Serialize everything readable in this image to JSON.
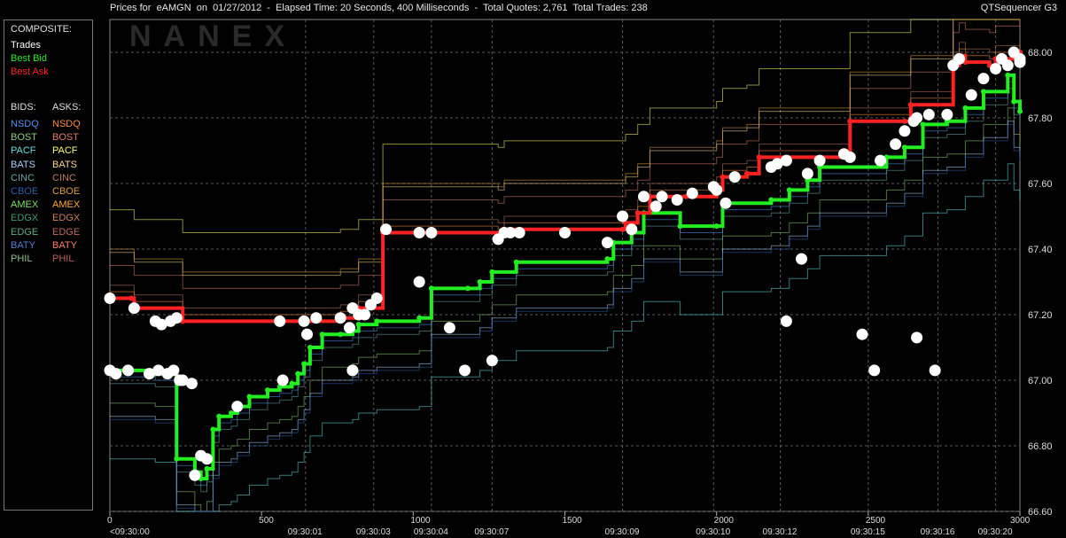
{
  "header": {
    "title": "Prices for  eAMGN  on  01/27/2012  -  Elapsed Time: 20 Seconds, 400 Milliseconds  -  Total Quotes: 2,761  Total Trades: 238",
    "app_name": "QTSequencer G3"
  },
  "watermark": "NANEX",
  "legend": {
    "composite_heading": "COMPOSITE:",
    "composite": [
      {
        "label": "Trades",
        "color": "#ffffff"
      },
      {
        "label": "Best Bid",
        "color": "#22ee22"
      },
      {
        "label": "Best Ask",
        "color": "#ff2222"
      }
    ],
    "bids_heading": "BIDS:",
    "asks_heading": "ASKS:",
    "bids": [
      {
        "label": "NSDQ",
        "color": "#4f8ff0"
      },
      {
        "label": "BOST",
        "color": "#8ed07a"
      },
      {
        "label": "PACF",
        "color": "#5fe0e0"
      },
      {
        "label": "BATS",
        "color": "#a8d0ff"
      },
      {
        "label": "CINC",
        "color": "#6aa7a7"
      },
      {
        "label": "CBOE",
        "color": "#2f5fb0"
      },
      {
        "label": "AMEX",
        "color": "#7be06a"
      },
      {
        "label": "EDGX",
        "color": "#3f9f6a"
      },
      {
        "label": "EDGE",
        "color": "#5fb080"
      },
      {
        "label": "BATY",
        "color": "#5a7fd0"
      },
      {
        "label": "PHIL",
        "color": "#8fbf8f"
      }
    ],
    "asks": [
      {
        "label": "NSDQ",
        "color": "#ff8c3a"
      },
      {
        "label": "BOST",
        "color": "#e07a6a"
      },
      {
        "label": "PACF",
        "color": "#ffff66"
      },
      {
        "label": "BATS",
        "color": "#ffd890"
      },
      {
        "label": "CINC",
        "color": "#c07a60"
      },
      {
        "label": "CBOE",
        "color": "#e0a040"
      },
      {
        "label": "AMEX",
        "color": "#ffaa22"
      },
      {
        "label": "EDGX",
        "color": "#d08060"
      },
      {
        "label": "EDGE",
        "color": "#c06a5a"
      },
      {
        "label": "BATY",
        "color": "#ff7a6a"
      },
      {
        "label": "PHIL",
        "color": "#c06060"
      }
    ]
  },
  "chart_data": {
    "type": "line",
    "xlim": [
      0,
      3000
    ],
    "ylim": [
      66.6,
      68.1
    ],
    "x_ticks": [
      0,
      500,
      1000,
      1500,
      2000,
      2500,
      3000
    ],
    "y_ticks": [
      "66.60",
      "66.80",
      "67.00",
      "67.20",
      "67.40",
      "67.60",
      "67.80",
      "68.00"
    ],
    "time_labels": [
      {
        "x": 0,
        "label": "<09:30:00"
      },
      {
        "x": 645,
        "label": "09:30:01"
      },
      {
        "x": 870,
        "label": "09:30:03"
      },
      {
        "x": 1060,
        "label": "09:30:04"
      },
      {
        "x": 1260,
        "label": "09:30:07"
      },
      {
        "x": 1690,
        "label": "09:30:09"
      },
      {
        "x": 1990,
        "label": "09:30:10"
      },
      {
        "x": 2210,
        "label": "09:30:12"
      },
      {
        "x": 2500,
        "label": "09:30:15"
      },
      {
        "x": 2730,
        "label": "09:30:16"
      },
      {
        "x": 2920,
        "label": "09:30:20"
      }
    ],
    "series": [
      {
        "name": "Best Bid",
        "color": "#22ee22",
        "points": [
          [
            0,
            67.03
          ],
          [
            150,
            67.02
          ],
          [
            200,
            67.02
          ],
          [
            220,
            66.76
          ],
          [
            280,
            66.72
          ],
          [
            300,
            66.7
          ],
          [
            320,
            66.73
          ],
          [
            340,
            66.85
          ],
          [
            360,
            66.89
          ],
          [
            400,
            66.9
          ],
          [
            420,
            66.92
          ],
          [
            460,
            66.95
          ],
          [
            520,
            66.97
          ],
          [
            560,
            66.98
          ],
          [
            600,
            66.99
          ],
          [
            620,
            67.02
          ],
          [
            640,
            67.05
          ],
          [
            660,
            67.1
          ],
          [
            700,
            67.14
          ],
          [
            760,
            67.14
          ],
          [
            800,
            67.15
          ],
          [
            820,
            67.17
          ],
          [
            880,
            67.18
          ],
          [
            1020,
            67.19
          ],
          [
            1060,
            67.28
          ],
          [
            1180,
            67.28
          ],
          [
            1220,
            67.3
          ],
          [
            1260,
            67.33
          ],
          [
            1340,
            67.36
          ],
          [
            1640,
            67.37
          ],
          [
            1660,
            67.42
          ],
          [
            1720,
            67.45
          ],
          [
            1760,
            67.51
          ],
          [
            1880,
            67.47
          ],
          [
            2000,
            67.47
          ],
          [
            2020,
            67.54
          ],
          [
            2180,
            67.55
          ],
          [
            2240,
            67.58
          ],
          [
            2300,
            67.61
          ],
          [
            2340,
            67.65
          ],
          [
            2560,
            67.68
          ],
          [
            2620,
            67.71
          ],
          [
            2680,
            67.78
          ],
          [
            2760,
            67.79
          ],
          [
            2820,
            67.83
          ],
          [
            2880,
            67.88
          ],
          [
            2960,
            67.93
          ],
          [
            2980,
            67.85
          ],
          [
            3000,
            67.82
          ]
        ]
      },
      {
        "name": "Best Ask",
        "color": "#ff2222",
        "points": [
          [
            0,
            67.25
          ],
          [
            70,
            67.25
          ],
          [
            80,
            67.22
          ],
          [
            240,
            67.18
          ],
          [
            560,
            67.18
          ],
          [
            760,
            67.19
          ],
          [
            820,
            67.22
          ],
          [
            900,
            67.45
          ],
          [
            1020,
            67.45
          ],
          [
            1280,
            67.44
          ],
          [
            1300,
            67.46
          ],
          [
            1690,
            67.46
          ],
          [
            1700,
            67.48
          ],
          [
            1740,
            67.51
          ],
          [
            1780,
            67.56
          ],
          [
            1900,
            67.56
          ],
          [
            2000,
            67.58
          ],
          [
            2020,
            67.62
          ],
          [
            2100,
            67.63
          ],
          [
            2140,
            67.68
          ],
          [
            2420,
            67.68
          ],
          [
            2440,
            67.79
          ],
          [
            2620,
            67.79
          ],
          [
            2640,
            67.84
          ],
          [
            2780,
            67.96
          ],
          [
            2800,
            67.99
          ],
          [
            2820,
            67.97
          ],
          [
            2900,
            67.96
          ],
          [
            2920,
            67.98
          ],
          [
            3000,
            68.0
          ]
        ]
      }
    ],
    "trades": [
      [
        0,
        67.25
      ],
      [
        0,
        67.03
      ],
      [
        20,
        67.02
      ],
      [
        60,
        67.03
      ],
      [
        80,
        67.22
      ],
      [
        130,
        67.02
      ],
      [
        150,
        67.18
      ],
      [
        160,
        67.03
      ],
      [
        170,
        67.17
      ],
      [
        190,
        67.02
      ],
      [
        200,
        67.18
      ],
      [
        210,
        67.03
      ],
      [
        220,
        67.19
      ],
      [
        230,
        67.0
      ],
      [
        240,
        67.0
      ],
      [
        270,
        66.99
      ],
      [
        280,
        66.71
      ],
      [
        300,
        66.77
      ],
      [
        320,
        66.76
      ],
      [
        420,
        66.92
      ],
      [
        560,
        67.18
      ],
      [
        570,
        67.0
      ],
      [
        640,
        67.18
      ],
      [
        650,
        67.14
      ],
      [
        680,
        67.19
      ],
      [
        760,
        67.19
      ],
      [
        790,
        67.16
      ],
      [
        800,
        67.03
      ],
      [
        800,
        67.22
      ],
      [
        820,
        67.2
      ],
      [
        840,
        67.2
      ],
      [
        860,
        67.23
      ],
      [
        880,
        67.25
      ],
      [
        910,
        67.46
      ],
      [
        1020,
        67.45
      ],
      [
        1020,
        67.3
      ],
      [
        1060,
        67.45
      ],
      [
        1120,
        67.16
      ],
      [
        1170,
        67.03
      ],
      [
        1260,
        67.06
      ],
      [
        1280,
        67.43
      ],
      [
        1300,
        67.45
      ],
      [
        1320,
        67.45
      ],
      [
        1350,
        67.45
      ],
      [
        1500,
        67.45
      ],
      [
        1640,
        67.42
      ],
      [
        1690,
        67.5
      ],
      [
        1720,
        67.46
      ],
      [
        1760,
        67.56
      ],
      [
        1800,
        67.53
      ],
      [
        1820,
        67.56
      ],
      [
        1870,
        67.55
      ],
      [
        1920,
        67.57
      ],
      [
        1990,
        67.59
      ],
      [
        2000,
        67.58
      ],
      [
        2030,
        67.54
      ],
      [
        2060,
        67.62
      ],
      [
        2180,
        67.65
      ],
      [
        2200,
        67.66
      ],
      [
        2230,
        67.67
      ],
      [
        2280,
        67.37
      ],
      [
        2230,
        67.18
      ],
      [
        2300,
        67.63
      ],
      [
        2340,
        67.67
      ],
      [
        2420,
        67.69
      ],
      [
        2440,
        67.68
      ],
      [
        2480,
        67.14
      ],
      [
        2520,
        67.03
      ],
      [
        2540,
        67.67
      ],
      [
        2590,
        67.72
      ],
      [
        2620,
        67.76
      ],
      [
        2650,
        67.79
      ],
      [
        2660,
        67.8
      ],
      [
        2700,
        67.81
      ],
      [
        2760,
        67.81
      ],
      [
        2840,
        67.87
      ],
      [
        2880,
        67.92
      ],
      [
        2920,
        67.95
      ],
      [
        2940,
        67.98
      ],
      [
        2960,
        67.96
      ],
      [
        3000,
        67.98
      ],
      [
        2780,
        67.96
      ],
      [
        2800,
        67.98
      ],
      [
        2660,
        67.13
      ],
      [
        2720,
        67.03
      ],
      [
        2980,
        68.0
      ],
      [
        3020,
        67.97
      ]
    ]
  }
}
